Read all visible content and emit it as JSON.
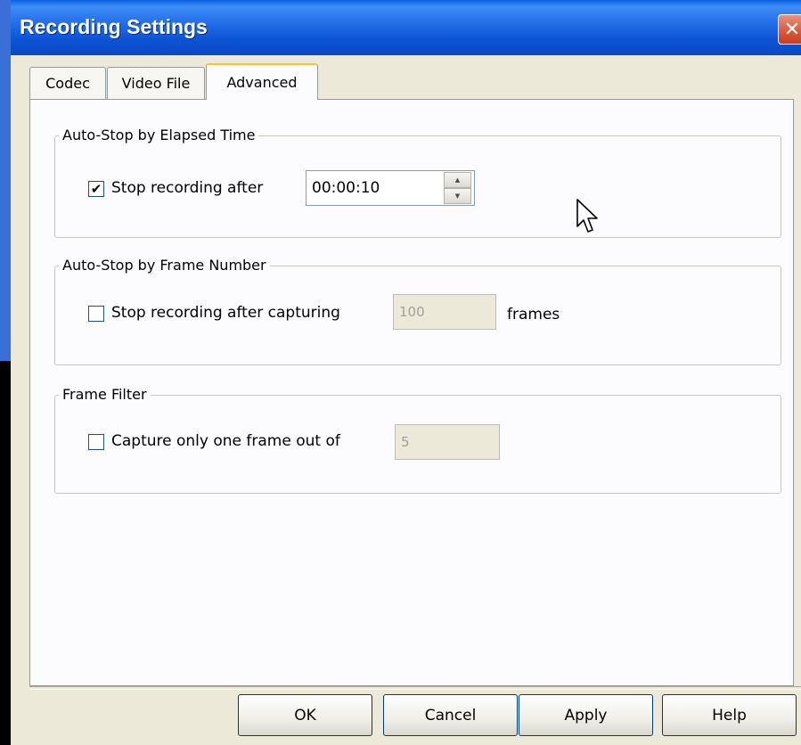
{
  "window": {
    "title": "Recording Settings",
    "close_glyph": "✕"
  },
  "tabs": [
    {
      "label": "Codec"
    },
    {
      "label": "Video File"
    },
    {
      "label": "Advanced",
      "active": true
    }
  ],
  "elapsed_group": {
    "title": "Auto-Stop by Elapsed Time",
    "checkbox_checked": true,
    "check_glyph": "✔",
    "label": "Stop recording after",
    "time_value": "00:00:10",
    "spin_up": "▲",
    "spin_down": "▼"
  },
  "frame_number_group": {
    "title": "Auto-Stop by Frame Number",
    "checkbox_checked": false,
    "label": "Stop recording after capturing",
    "frames_value": "100",
    "suffix": "frames"
  },
  "filter_group": {
    "title": "Frame Filter",
    "checkbox_checked": false,
    "label": "Capture only one frame out of",
    "value": "5"
  },
  "buttons": {
    "ok": "OK",
    "cancel": "Cancel",
    "apply": "Apply",
    "help": "Help"
  },
  "colors": {
    "titlebar": "#0d55d6",
    "dialog_bg": "#ece9d8",
    "close": "#d8563b",
    "active_tab_accent": "#f5c04a"
  },
  "icons": [
    "close-icon",
    "check-icon",
    "spin-up-icon",
    "spin-down-icon",
    "mouse-cursor-icon"
  ]
}
